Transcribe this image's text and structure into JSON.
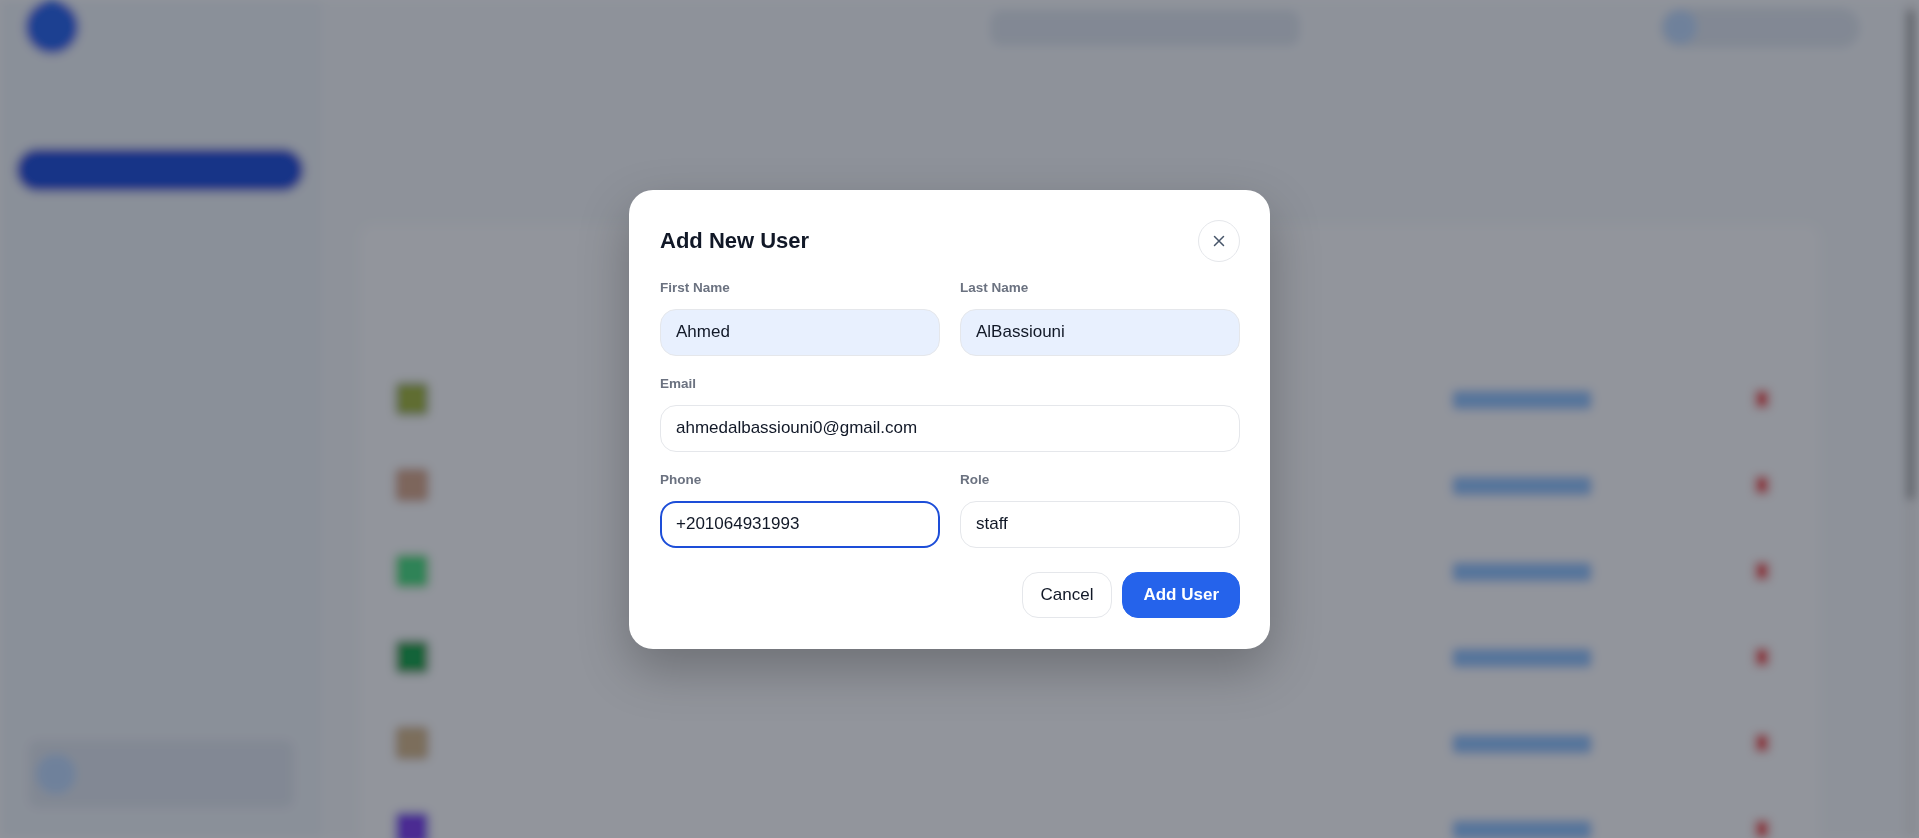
{
  "dialog": {
    "title": "Add New User",
    "form_rows": [
      [
        {
          "label": "First Name",
          "value": "Ahmed",
          "autofilled": true,
          "focused": false
        },
        {
          "label": "Last Name",
          "value": "AlBassiouni",
          "autofilled": true,
          "focused": false
        }
      ],
      [
        {
          "label": "Email",
          "value": "ahmedalbassiouni0@gmail.com",
          "autofilled": false,
          "focused": false
        }
      ],
      [
        {
          "label": "Phone",
          "value": "+201064931993",
          "autofilled": false,
          "focused": true
        },
        {
          "label": "Role",
          "value": "staff",
          "autofilled": false,
          "focused": false
        }
      ]
    ],
    "buttons": [
      {
        "label": "Cancel",
        "kind": "secondary"
      },
      {
        "label": "Add User",
        "kind": "primary"
      }
    ]
  }
}
